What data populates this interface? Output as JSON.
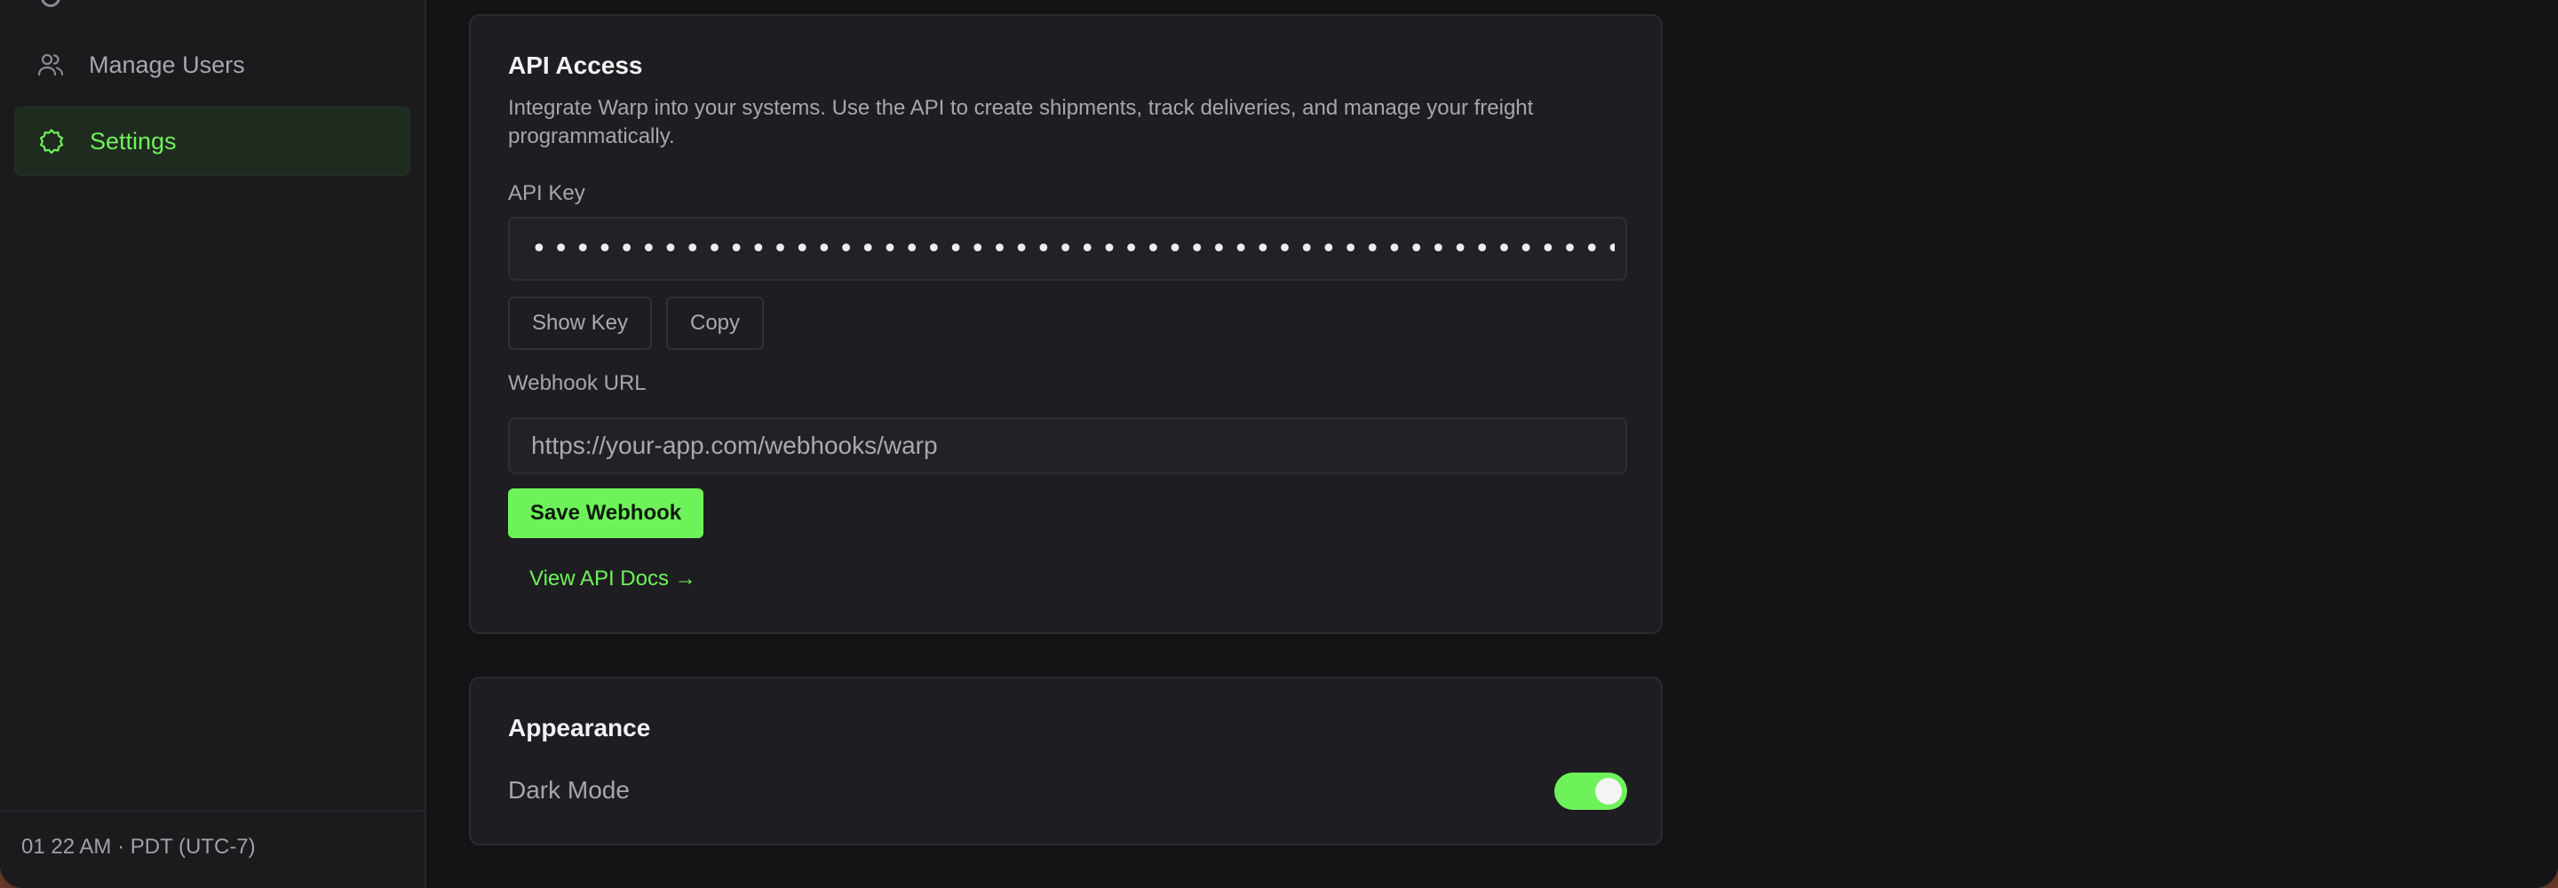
{
  "sidebar": {
    "items": [
      {
        "label": "Manage Users",
        "icon": "users-icon"
      },
      {
        "label": "Settings",
        "icon": "gear-icon",
        "active": true
      }
    ],
    "clock": "01 22 AM · PDT (UTC-7)"
  },
  "api_access": {
    "title": "API Access",
    "description": "Integrate Warp into your systems. Use the API to create shipments, track deliveries, and manage your freight programmatically.",
    "api_key_label": "API Key",
    "api_key_value": "••••••••••••••••••••••••••••••••••••••••••••••••••••••••••••••••••••••••••••••••",
    "show_key_label": "Show Key",
    "copy_label": "Copy",
    "webhook_label": "Webhook URL",
    "webhook_placeholder": "https://your-app.com/webhooks/warp",
    "save_webhook_label": "Save Webhook",
    "docs_link_label": "View API Docs →"
  },
  "appearance": {
    "title": "Appearance",
    "dark_mode_label": "Dark Mode",
    "dark_mode_on": true
  },
  "colors": {
    "accent": "#6ef25a",
    "background": "#131316",
    "card": "#1e1e22"
  }
}
